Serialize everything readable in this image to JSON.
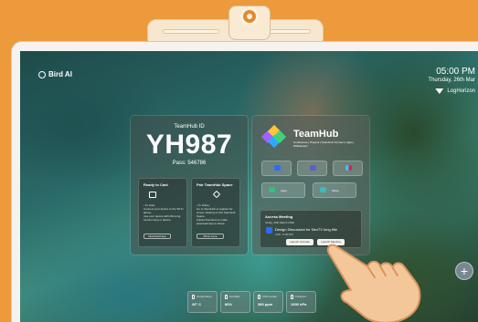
{
  "brand": {
    "name": "Bird AI"
  },
  "clock": {
    "time": "05:00 PM",
    "date": "Thursday, 26th Mar"
  },
  "network": {
    "name": "LogHorizon"
  },
  "teamhub_id": {
    "title": "TeamHub ID",
    "code": "YH987",
    "pass": "Pass: 546786",
    "cast_card": {
      "heading": "Ready to Cast",
      "lines": [
        "• To Cast:",
        "Connect your device to the Wi-Fi above.",
        "Use your device with Mirroring function App or device."
      ],
      "button": "Download App"
    },
    "pair_card": {
      "heading": "Pair TeamHub Space",
      "lines": [
        "• To Share:",
        "Go to TeamHub to register for screen sharing on the TeamHub Space.",
        "Follow directions to make download App to share."
      ],
      "button": "Show more"
    }
  },
  "teamhub": {
    "name": "TeamHub",
    "tagline": "Conference | Present | TeamHub Connect | Apps | Whiteboard",
    "tiles": [
      "zoom",
      "teams",
      "slack"
    ],
    "wide_tiles": [
      {
        "label": "Apps"
      },
      {
        "label": "Setup"
      }
    ],
    "meeting": {
      "heading": "Access Meeting",
      "time": "Today, 26th March 2020",
      "title": "Design Discussion for NexTV long title",
      "subtitle": "4:00 - 5:00 PM",
      "join_label": "Launch Console",
      "host_label": "Launch Meeting"
    }
  },
  "widgets": [
    {
      "label": "Temperature",
      "value": "26° C"
    },
    {
      "label": "Humidity",
      "value": "80%"
    },
    {
      "label": "CO2 Levels",
      "value": "380 ppm"
    },
    {
      "label": "Pressure",
      "value": "1000 hPa"
    }
  ],
  "add_button": "+",
  "colors": {
    "background": "#ec9a3c",
    "accent_zoom": "#2d6bff"
  }
}
